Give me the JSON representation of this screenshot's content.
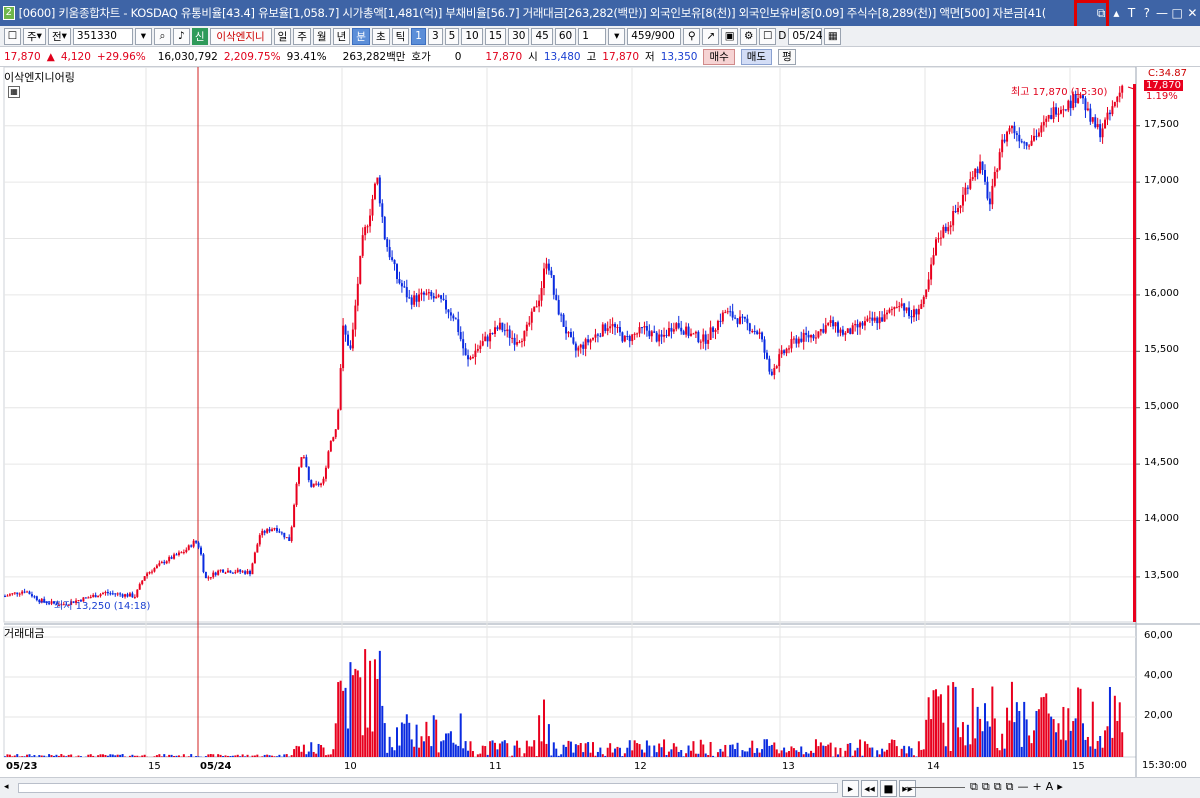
{
  "titlebar": {
    "badge": "2",
    "text": "[0600] 키움종합차트 - KOSDAQ 유통비율[43.4] 유보율[1,058.7] 시가총액[1,481(억)] 부채비율[56.7] 거래대금[263,282(백만)] 외국인보유[8(천)] 외국인보유비중[0.09] 주식수[8,289(천)] 액면[500] 자본금[41(",
    "buttons": [
      "⧉",
      "▴",
      "T",
      "?",
      "—",
      "□",
      "✕"
    ]
  },
  "toolbar1": {
    "period": "주",
    "market": "전",
    "code": "351330",
    "new_label": "신",
    "stock_name": "이삭엔지니",
    "periods": [
      "일",
      "주",
      "월",
      "년",
      "분",
      "초",
      "틱"
    ],
    "minutes": [
      "1",
      "3",
      "5",
      "10",
      "15",
      "30",
      "45",
      "60"
    ],
    "minute_select": "1",
    "count": "459/900",
    "date": "05/24",
    "d_label": "D"
  },
  "toolbar2": {
    "price": "17,870",
    "change": "4,120",
    "change_pct": "+29.96%",
    "volume": "16,030,792",
    "vol_pct": "2,209.75%",
    "ratio": "93.41%",
    "amount": "263,282백만",
    "hoga_label": "호가",
    "hoga": "0",
    "hoga_price": "17,870",
    "open_label": "시",
    "open": "13,480",
    "high_label": "고",
    "high": "17,870",
    "low_label": "저",
    "low": "13,350",
    "buy": "매수",
    "sell": "매도",
    "avg": "평"
  },
  "chart": {
    "main_label": "이삭엔지니어링",
    "vol_label": "거래대금",
    "max_label": "최고 17,870 (15:30)",
    "min_label": "최저 13,250 (14:18)",
    "right_top": "C:34.87",
    "current_price": "17,870",
    "current_pct": "1.19%",
    "time_label": "15:30:00",
    "price_ticks": [
      "17,500",
      "17,000",
      "16,500",
      "16,000",
      "15,500",
      "15,000",
      "14,500",
      "14,000",
      "13,500"
    ],
    "vol_ticks": [
      "60,00",
      "40,00",
      "20,00"
    ],
    "x_labels": [
      "05/23",
      "15",
      "05/24",
      "10",
      "11",
      "12",
      "13",
      "14",
      "15"
    ],
    "colors": {
      "up": "#e8001e",
      "down": "#0a2be0",
      "grid": "#e6e6e6",
      "cursor": "#d02020"
    }
  },
  "chart_data": {
    "type": "candlestick",
    "ylim": [
      13100,
      17950
    ],
    "max": 17870,
    "min": 13250,
    "vol_ylim": [
      0,
      65
    ],
    "anchors": [
      [
        0,
        13330
      ],
      [
        20,
        13380
      ],
      [
        35,
        13290
      ],
      [
        55,
        13250
      ],
      [
        80,
        13310
      ],
      [
        100,
        13360
      ],
      [
        130,
        13330
      ],
      [
        140,
        13520
      ],
      [
        160,
        13640
      ],
      [
        180,
        13730
      ],
      [
        190,
        13820
      ],
      [
        195,
        13750
      ],
      [
        200,
        13480
      ],
      [
        215,
        13560
      ],
      [
        245,
        13540
      ],
      [
        255,
        13880
      ],
      [
        270,
        13940
      ],
      [
        285,
        13820
      ],
      [
        292,
        14380
      ],
      [
        298,
        14600
      ],
      [
        305,
        14300
      ],
      [
        318,
        14330
      ],
      [
        325,
        14700
      ],
      [
        332,
        14850
      ],
      [
        338,
        15700
      ],
      [
        346,
        15500
      ],
      [
        352,
        16050
      ],
      [
        358,
        16500
      ],
      [
        364,
        16700
      ],
      [
        372,
        17050
      ],
      [
        380,
        16500
      ],
      [
        392,
        16150
      ],
      [
        405,
        15950
      ],
      [
        420,
        16000
      ],
      [
        435,
        15950
      ],
      [
        450,
        15800
      ],
      [
        462,
        15400
      ],
      [
        470,
        15500
      ],
      [
        480,
        15600
      ],
      [
        495,
        15720
      ],
      [
        510,
        15600
      ],
      [
        520,
        15650
      ],
      [
        535,
        16000
      ],
      [
        542,
        16350
      ],
      [
        550,
        15950
      ],
      [
        560,
        15700
      ],
      [
        570,
        15500
      ],
      [
        585,
        15600
      ],
      [
        605,
        15750
      ],
      [
        620,
        15600
      ],
      [
        640,
        15700
      ],
      [
        655,
        15600
      ],
      [
        670,
        15750
      ],
      [
        685,
        15650
      ],
      [
        700,
        15600
      ],
      [
        720,
        15850
      ],
      [
        740,
        15750
      ],
      [
        755,
        15650
      ],
      [
        765,
        15300
      ],
      [
        775,
        15450
      ],
      [
        790,
        15600
      ],
      [
        810,
        15650
      ],
      [
        825,
        15750
      ],
      [
        840,
        15650
      ],
      [
        860,
        15750
      ],
      [
        880,
        15800
      ],
      [
        895,
        15950
      ],
      [
        905,
        15800
      ],
      [
        920,
        15950
      ],
      [
        932,
        16500
      ],
      [
        945,
        16650
      ],
      [
        955,
        16800
      ],
      [
        965,
        17050
      ],
      [
        975,
        17150
      ],
      [
        985,
        16800
      ],
      [
        995,
        17300
      ],
      [
        1005,
        17500
      ],
      [
        1020,
        17350
      ],
      [
        1035,
        17450
      ],
      [
        1050,
        17650
      ],
      [
        1065,
        17700
      ],
      [
        1075,
        17800
      ],
      [
        1085,
        17550
      ],
      [
        1095,
        17450
      ],
      [
        1105,
        17600
      ],
      [
        1118,
        17870
      ]
    ]
  }
}
